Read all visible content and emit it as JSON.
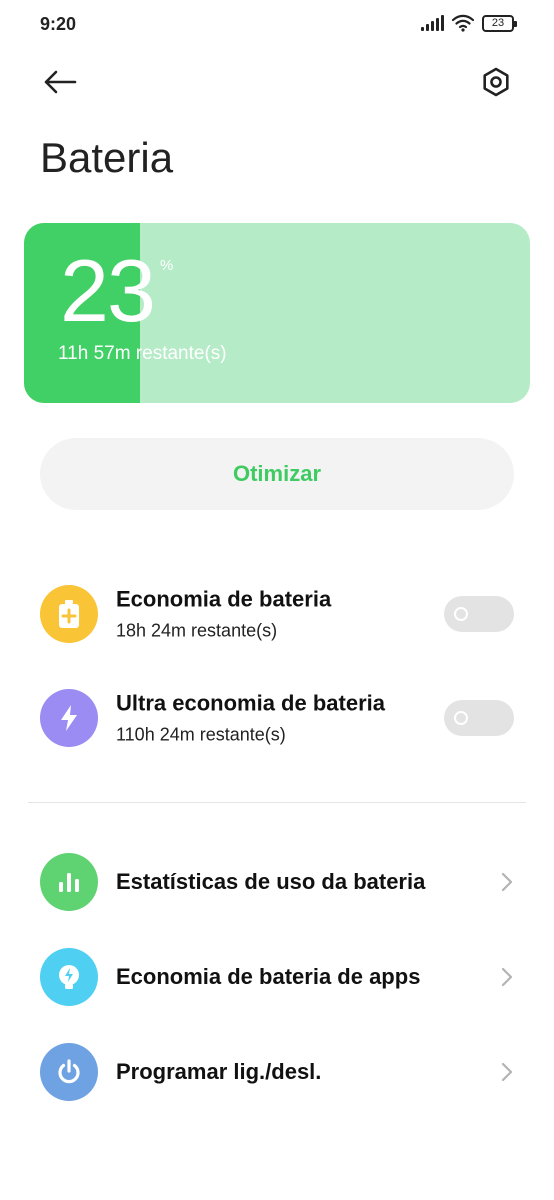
{
  "status_bar": {
    "time": "9:20",
    "battery": "23"
  },
  "header": {
    "title": "Bateria"
  },
  "battery_card": {
    "level": 0.23,
    "percent": "23",
    "percent_sign": "%",
    "remaining": "11h 57m restante(s)"
  },
  "optimize_label": "Otimizar",
  "modes": [
    {
      "title": "Economia de bateria",
      "subtitle": "18h 24m restante(s)",
      "enabled": false,
      "icon": "battery-saver-icon",
      "color": "#f9c435"
    },
    {
      "title": "Ultra economia de bateria",
      "subtitle": "110h 24m restante(s)",
      "enabled": false,
      "icon": "lightning-icon",
      "color": "#9a8cf2"
    }
  ],
  "links": [
    {
      "title": "Estatísticas de uso da bateria",
      "icon": "bar-chart-icon",
      "color": "#5fd372"
    },
    {
      "title": "Economia de bateria de apps",
      "icon": "app-saver-icon",
      "color": "#4fcff2"
    },
    {
      "title": "Programar lig./desl.",
      "icon": "power-icon",
      "color": "#6fa2e2"
    }
  ],
  "colors": {
    "accent_green": "#41d065",
    "card_bg": "#b5ebc7",
    "optimize_text": "#3fcb62"
  }
}
